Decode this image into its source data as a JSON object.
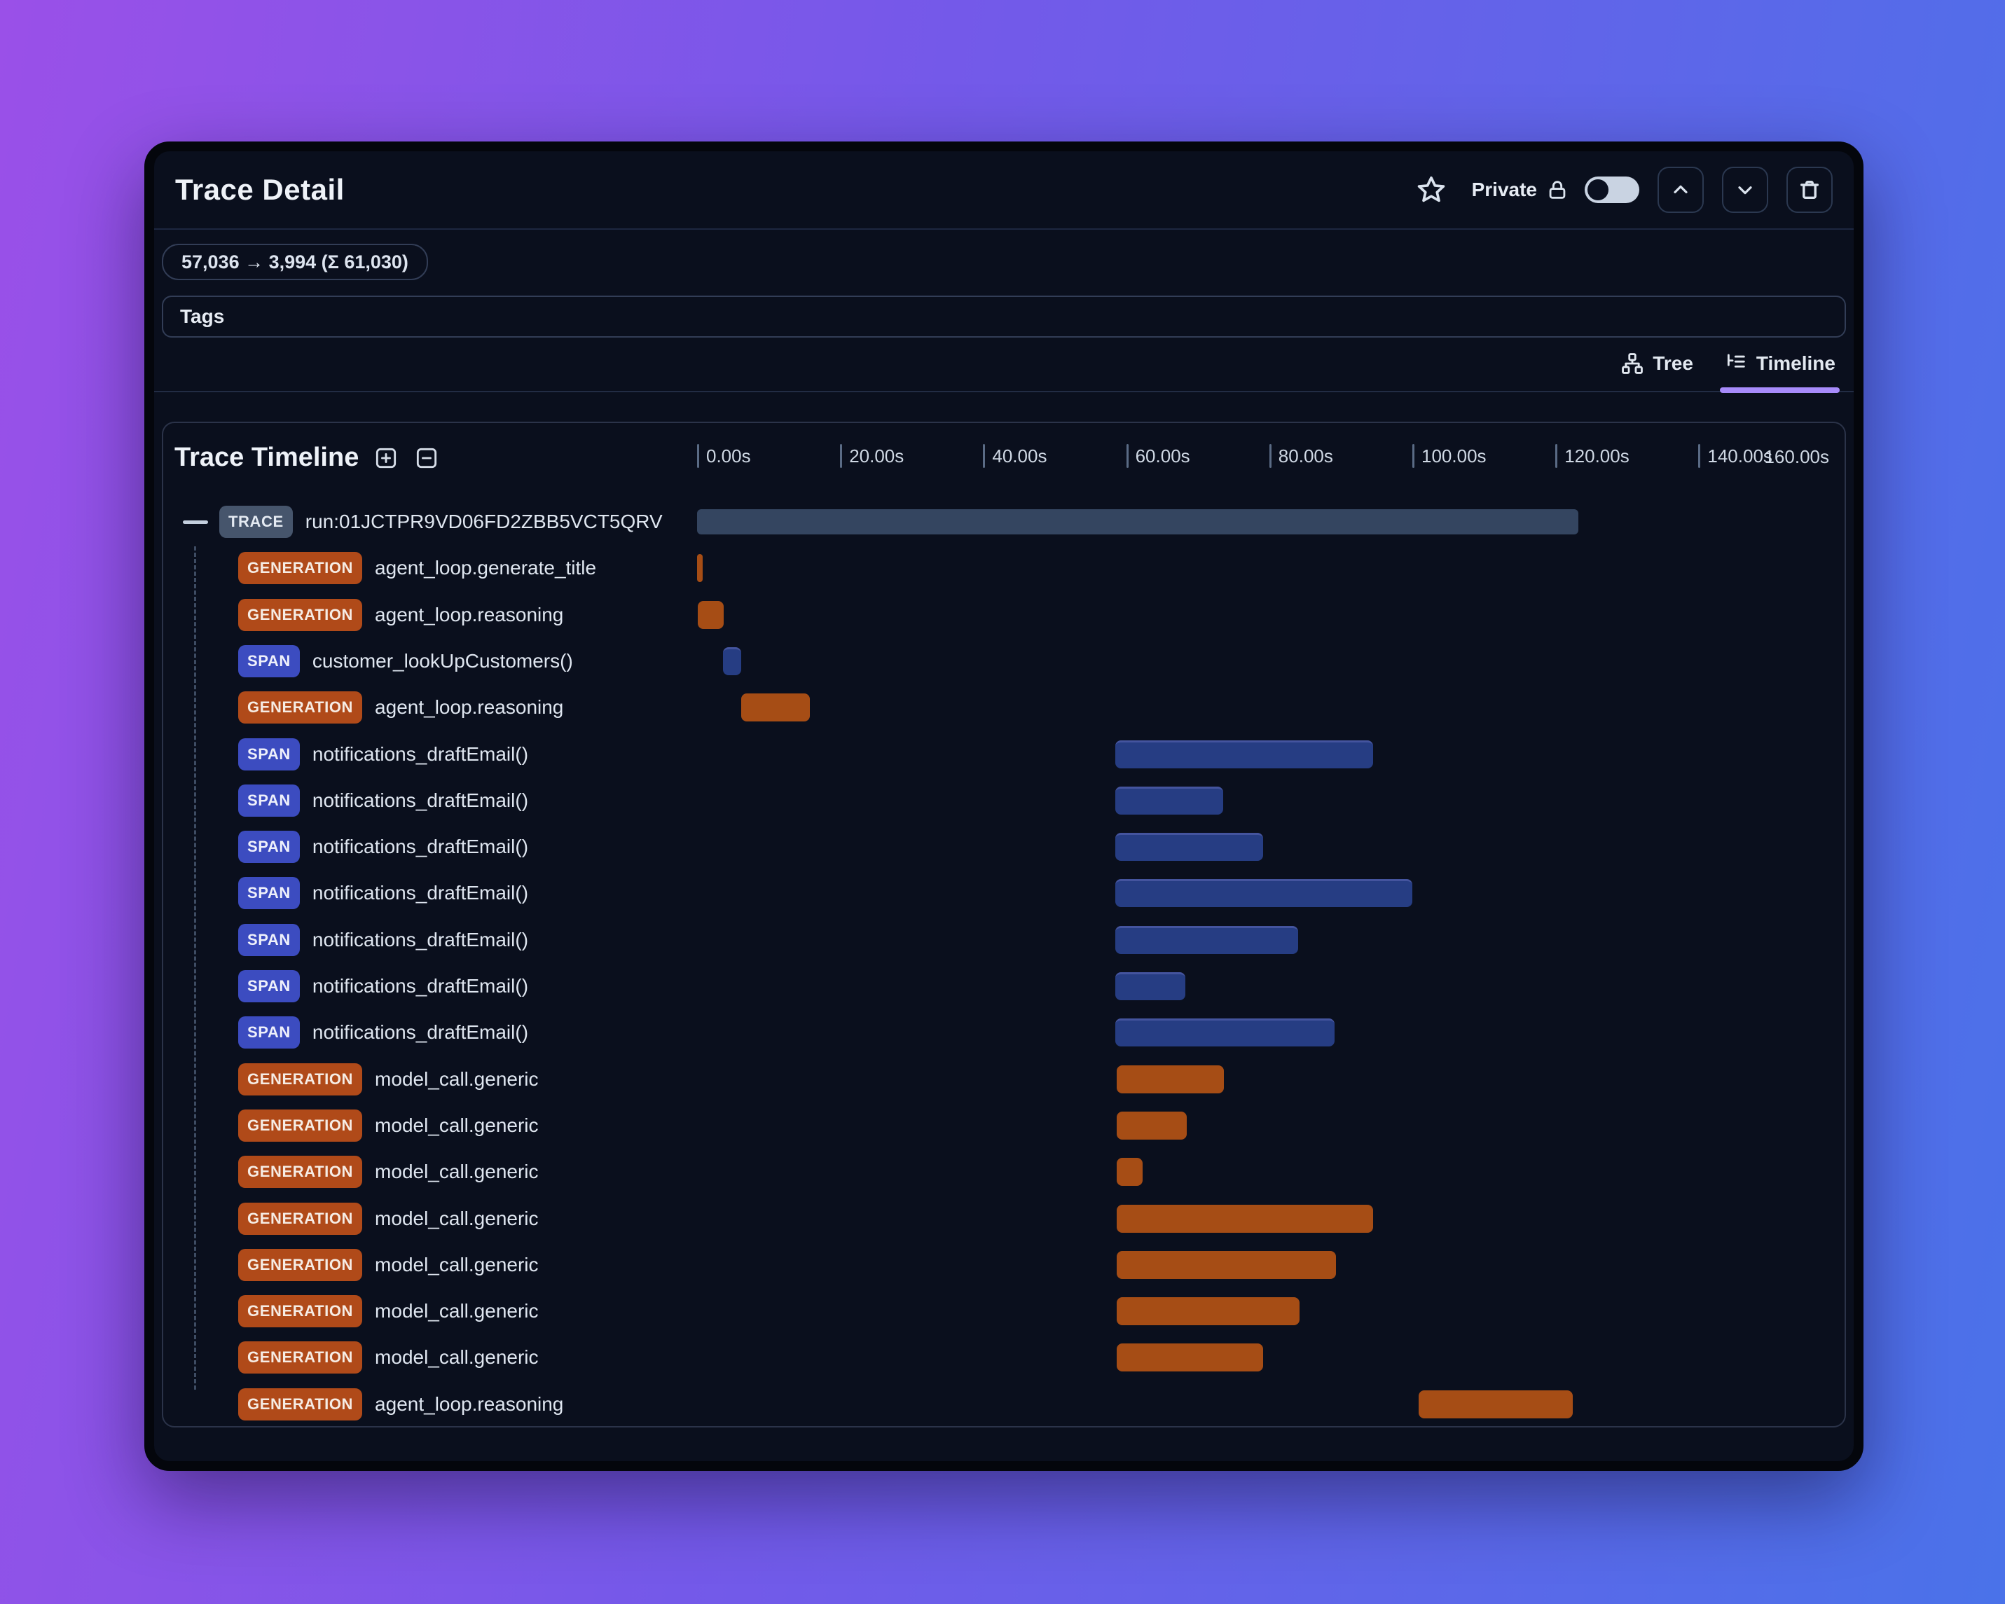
{
  "window": {
    "title": "Trace Detail"
  },
  "header": {
    "star_icon": "star-outline",
    "privacy": {
      "label": "Private",
      "lock_icon": "lock",
      "toggle_state": "off"
    },
    "buttons": {
      "up_icon": "chevron-up",
      "down_icon": "chevron-down",
      "delete_icon": "trash"
    }
  },
  "usage_pill": {
    "text": "57,036 → 3,994 (Σ 61,030)"
  },
  "tags": {
    "label": "Tags"
  },
  "view_tabs": {
    "tree": {
      "label": "Tree",
      "icon": "tree-hierarchy",
      "active": false
    },
    "timeline": {
      "label": "Timeline",
      "icon": "timeline-list",
      "active": true
    }
  },
  "timeline_panel": {
    "title": "Trace Timeline",
    "expand_all_icon": "plus-square",
    "collapse_all_icon": "minus-square",
    "axis": {
      "unit": "seconds",
      "range_s": [
        0,
        160
      ],
      "ticks": [
        {
          "label": "0.00s",
          "seconds": 0
        },
        {
          "label": "20.00s",
          "seconds": 20
        },
        {
          "label": "40.00s",
          "seconds": 40
        },
        {
          "label": "60.00s",
          "seconds": 60
        },
        {
          "label": "80.00s",
          "seconds": 80
        },
        {
          "label": "100.00s",
          "seconds": 100
        },
        {
          "label": "120.00s",
          "seconds": 120
        },
        {
          "label": "140.00s",
          "seconds": 140
        }
      ],
      "end_label": "160.00s"
    },
    "rows": [
      {
        "type": "TRACE",
        "label": "run:01JCTPR9VD06FD2ZBB5VCT5QRV",
        "start_s": 0,
        "end_s": 123.2,
        "has_collapser": true
      },
      {
        "type": "GENERATION",
        "label": "agent_loop.generate_title",
        "start_s": 0,
        "end_s": 0.7
      },
      {
        "type": "GENERATION",
        "label": "agent_loop.reasoning",
        "start_s": 0.1,
        "end_s": 3.7
      },
      {
        "type": "SPAN",
        "label": "customer_lookUpCustomers()",
        "start_s": 3.6,
        "end_s": 6.2
      },
      {
        "type": "GENERATION",
        "label": "agent_loop.reasoning",
        "start_s": 6.2,
        "end_s": 15.8
      },
      {
        "type": "SPAN",
        "label": "notifications_draftEmail()",
        "start_s": 58.5,
        "end_s": 94.5
      },
      {
        "type": "SPAN",
        "label": "notifications_draftEmail()",
        "start_s": 58.5,
        "end_s": 73.6
      },
      {
        "type": "SPAN",
        "label": "notifications_draftEmail()",
        "start_s": 58.5,
        "end_s": 79.1
      },
      {
        "type": "SPAN",
        "label": "notifications_draftEmail()",
        "start_s": 58.5,
        "end_s": 100.0
      },
      {
        "type": "SPAN",
        "label": "notifications_draftEmail()",
        "start_s": 58.5,
        "end_s": 84.0
      },
      {
        "type": "SPAN",
        "label": "notifications_draftEmail()",
        "start_s": 58.5,
        "end_s": 68.3
      },
      {
        "type": "SPAN",
        "label": "notifications_draftEmail()",
        "start_s": 58.5,
        "end_s": 89.1
      },
      {
        "type": "GENERATION",
        "label": "model_call.generic",
        "start_s": 58.7,
        "end_s": 73.7
      },
      {
        "type": "GENERATION",
        "label": "model_call.generic",
        "start_s": 58.7,
        "end_s": 68.5
      },
      {
        "type": "GENERATION",
        "label": "model_call.generic",
        "start_s": 58.7,
        "end_s": 62.3
      },
      {
        "type": "GENERATION",
        "label": "model_call.generic",
        "start_s": 58.7,
        "end_s": 94.5
      },
      {
        "type": "GENERATION",
        "label": "model_call.generic",
        "start_s": 58.7,
        "end_s": 89.3
      },
      {
        "type": "GENERATION",
        "label": "model_call.generic",
        "start_s": 58.7,
        "end_s": 84.2
      },
      {
        "type": "GENERATION",
        "label": "model_call.generic",
        "start_s": 58.7,
        "end_s": 79.1
      },
      {
        "type": "GENERATION",
        "label": "agent_loop.reasoning",
        "start_s": 100.9,
        "end_s": 122.4
      }
    ]
  },
  "colors": {
    "backdrop_gradient": [
      "#9a50e8",
      "#4a72e9"
    ],
    "window_bg": "#0a0f1d",
    "trace_badge": "#46556c",
    "generation_badge": "#b04a19",
    "span_badge": "#3c4cc0",
    "trace_bar": "#344560",
    "generation_bar": "#a64d15",
    "span_bar": "#263d83",
    "active_tab_underline": "#a78bfa"
  }
}
